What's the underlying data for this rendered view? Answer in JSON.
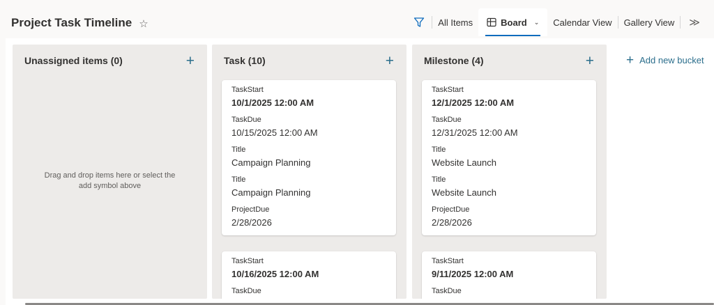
{
  "header": {
    "title": "Project Task Timeline",
    "favorite_icon": "star-outline-icon"
  },
  "views": {
    "filter_icon": "filter-icon",
    "items": [
      {
        "label": "All Items",
        "active": false
      },
      {
        "label": "Board",
        "active": true,
        "icon": "board-icon"
      },
      {
        "label": "Calendar View",
        "active": false
      },
      {
        "label": "Gallery View",
        "active": false
      }
    ],
    "more_icon": "double-chevron-right-icon"
  },
  "buckets": [
    {
      "title": "Unassigned items (0)",
      "empty_hint": "Drag and drop items here or select the add symbol above",
      "cards": []
    },
    {
      "title": "Task (10)",
      "cards": [
        {
          "fields": [
            {
              "label": "TaskStart",
              "value": "10/1/2025 12:00 AM"
            },
            {
              "label": "TaskDue",
              "value": "10/15/2025 12:00 AM"
            },
            {
              "label": "Title",
              "value": "Campaign Planning"
            },
            {
              "label": "Title",
              "value": "Campaign Planning"
            },
            {
              "label": "ProjectDue",
              "value": "2/28/2026"
            }
          ]
        },
        {
          "fields": [
            {
              "label": "TaskStart",
              "value": "10/16/2025 12:00 AM"
            },
            {
              "label": "TaskDue",
              "value": ""
            }
          ]
        }
      ]
    },
    {
      "title": "Milestone (4)",
      "cards": [
        {
          "fields": [
            {
              "label": "TaskStart",
              "value": "12/1/2025 12:00 AM"
            },
            {
              "label": "TaskDue",
              "value": "12/31/2025 12:00 AM"
            },
            {
              "label": "Title",
              "value": "Website Launch"
            },
            {
              "label": "Title",
              "value": "Website Launch"
            },
            {
              "label": "ProjectDue",
              "value": "2/28/2026"
            }
          ]
        },
        {
          "fields": [
            {
              "label": "TaskStart",
              "value": "9/11/2025 12:00 AM"
            },
            {
              "label": "TaskDue",
              "value": ""
            }
          ]
        }
      ]
    }
  ],
  "add_bucket_label": "Add new bucket",
  "colors": {
    "accent": "#0f6cbd",
    "link": "#2b6e8c",
    "bucket_bg": "#edebe9"
  }
}
